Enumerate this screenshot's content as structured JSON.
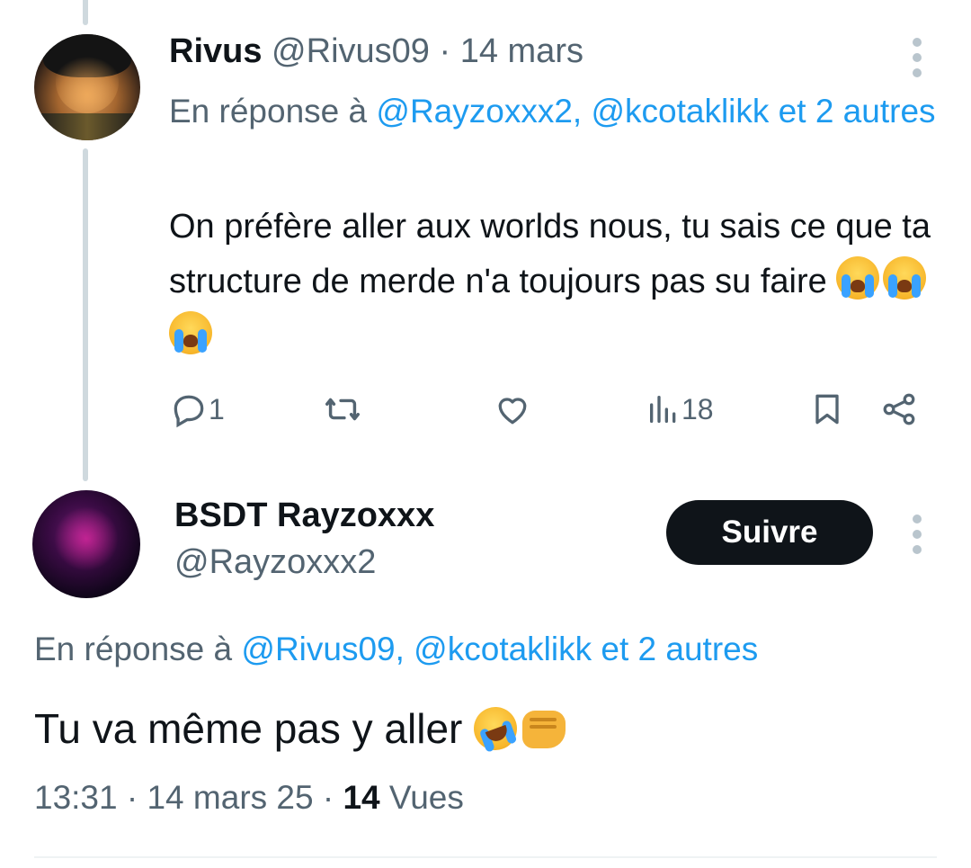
{
  "tweet1": {
    "author_name": "Rivus",
    "author_handle": "@Rivus09",
    "separator": "·",
    "date": "14 mars",
    "reply_prefix": "En réponse à ",
    "reply_mentions": "@Rayzoxxx2, @kcotaklikk",
    "reply_and": " et",
    "reply_others": "2 autres",
    "text": "On préfère aller aux worlds nous, tu sais ce que ta structure de merde n'a toujours pas su faire",
    "emojis": "loudly-crying-face x3",
    "reply_count": "1",
    "views_count": "18",
    "icons": [
      "reply-icon",
      "retweet-icon",
      "like-icon",
      "views-icon",
      "bookmark-icon",
      "share-icon",
      "more-icon"
    ]
  },
  "tweet2": {
    "author_name": "BSDT Rayzoxxx",
    "author_handle": "@Rayzoxxx2",
    "follow_label": "Suivre",
    "reply_prefix": "En réponse à ",
    "reply_mentions": "@Rivus09, @kcotaklikk",
    "reply_rest": " et 2 autres",
    "text": "Tu va même pas y aller",
    "emojis": "rolling-on-floor-laughing, oncoming-fist",
    "time": "13:31",
    "separator": "·",
    "date": "14 mars 25",
    "views_count": "14",
    "views_label": "Vues"
  },
  "colors": {
    "link": "#1d9bf0",
    "muted": "#536471",
    "text": "#0f1419",
    "follow_button_bg": "#0f1419",
    "thread_line": "#cfd9de"
  }
}
